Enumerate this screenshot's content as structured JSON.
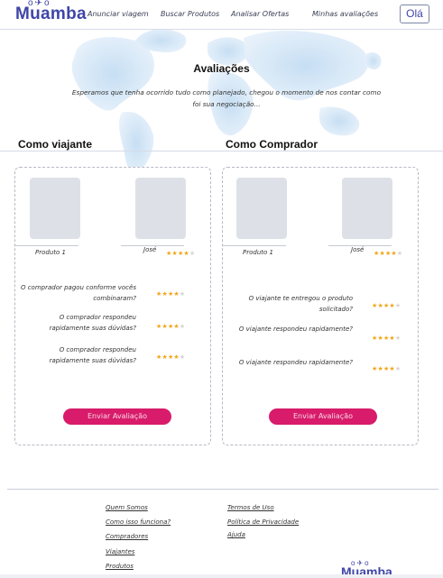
{
  "header": {
    "logo": "Muamba",
    "logo_mark": "o✈o",
    "nav": [
      "Anunciar viagem",
      "Buscar Produtos",
      "Analisar Ofertas",
      "Minhas avaliações"
    ],
    "greeting_button": "Olá"
  },
  "main": {
    "title": "Avaliações",
    "intro": "Esperamos que tenha ocorrido tudo como planejado, chegou o momento de nos contar como foi sua negociação..."
  },
  "traveler": {
    "heading": "Como viajante",
    "product_label": "Produto 1",
    "person_name": "José",
    "person_rating": 4,
    "questions": [
      {
        "text": "O comprador pagou conforme vocês combinaram?",
        "rating": 4
      },
      {
        "text": "O comprador respondeu rapidamente suas dúvidas?",
        "rating": 4
      },
      {
        "text": "O comprador respondeu rapidamente suas dúvidas?",
        "rating": 4
      }
    ],
    "submit_label": "Enviar Avaliação"
  },
  "buyer": {
    "heading": "Como Comprador",
    "product_label": "Produto 1",
    "person_name": "José",
    "person_rating": 4,
    "questions": [
      {
        "text": "O viajante te entregou o produto solicitado?",
        "rating": 4
      },
      {
        "text": "O viajante respondeu rapidamente?",
        "rating": 4
      },
      {
        "text": "O viajante respondeu rapidamente?",
        "rating": 4
      }
    ],
    "submit_label": "Enviar Avaliação"
  },
  "footer": {
    "links_col1": [
      "Quem Somos",
      "Como isso funciona?",
      "Compradores",
      "Viajantes",
      "Produtos"
    ],
    "links_col2": [
      "Termos de Uso",
      "Política de Privacidade",
      "Ajuda"
    ],
    "logo": "Muamba",
    "logo_mark": "o✈o"
  },
  "colors": {
    "brand": "#3f45a8",
    "accent_button": "#d81b6a",
    "star": "#f2a516",
    "map": "#cfe4f6"
  },
  "icons": [
    "plane-icon",
    "star-icon",
    "world-map"
  ]
}
